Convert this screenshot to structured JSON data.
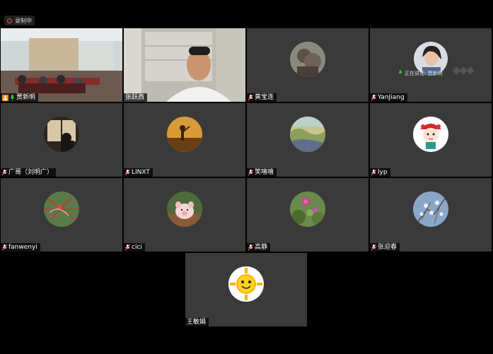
{
  "recording": {
    "label": "录制中"
  },
  "speaking_indicator": {
    "label": "正在讲话: 贾新明"
  },
  "participants": [
    {
      "name": "贾新明",
      "avatar": "classroom-video",
      "host": true,
      "mic": "on"
    },
    {
      "name": "张跃西",
      "avatar": "man-in-office-video",
      "host": false,
      "mic": "none"
    },
    {
      "name": "黄宝连",
      "avatar": "statue-photo",
      "host": false,
      "mic": "muted"
    },
    {
      "name": "YanJiang",
      "avatar": "woman-portrait",
      "host": false,
      "mic": "muted"
    },
    {
      "name": "广哥（刘明广）",
      "avatar": "silhouette-window",
      "host": false,
      "mic": "muted"
    },
    {
      "name": "LINXT",
      "avatar": "sunset-silhouette",
      "host": false,
      "mic": "muted"
    },
    {
      "name": "笑嘻嘻",
      "avatar": "painting-landscape",
      "host": false,
      "mic": "muted"
    },
    {
      "name": "lyp",
      "avatar": "opera-cartoon",
      "host": false,
      "mic": "muted"
    },
    {
      "name": "fanwenyi",
      "avatar": "map-thumbnail",
      "host": false,
      "mic": "muted"
    },
    {
      "name": "cici",
      "avatar": "piglet-photo",
      "host": false,
      "mic": "muted"
    },
    {
      "name": "高静",
      "avatar": "flower-photo",
      "host": false,
      "mic": "muted"
    },
    {
      "name": "张迎春",
      "avatar": "blossom-photo",
      "host": false,
      "mic": "muted"
    },
    {
      "name": "王敏娟",
      "avatar": "sun-emoji",
      "host": false,
      "mic": "none"
    }
  ]
}
